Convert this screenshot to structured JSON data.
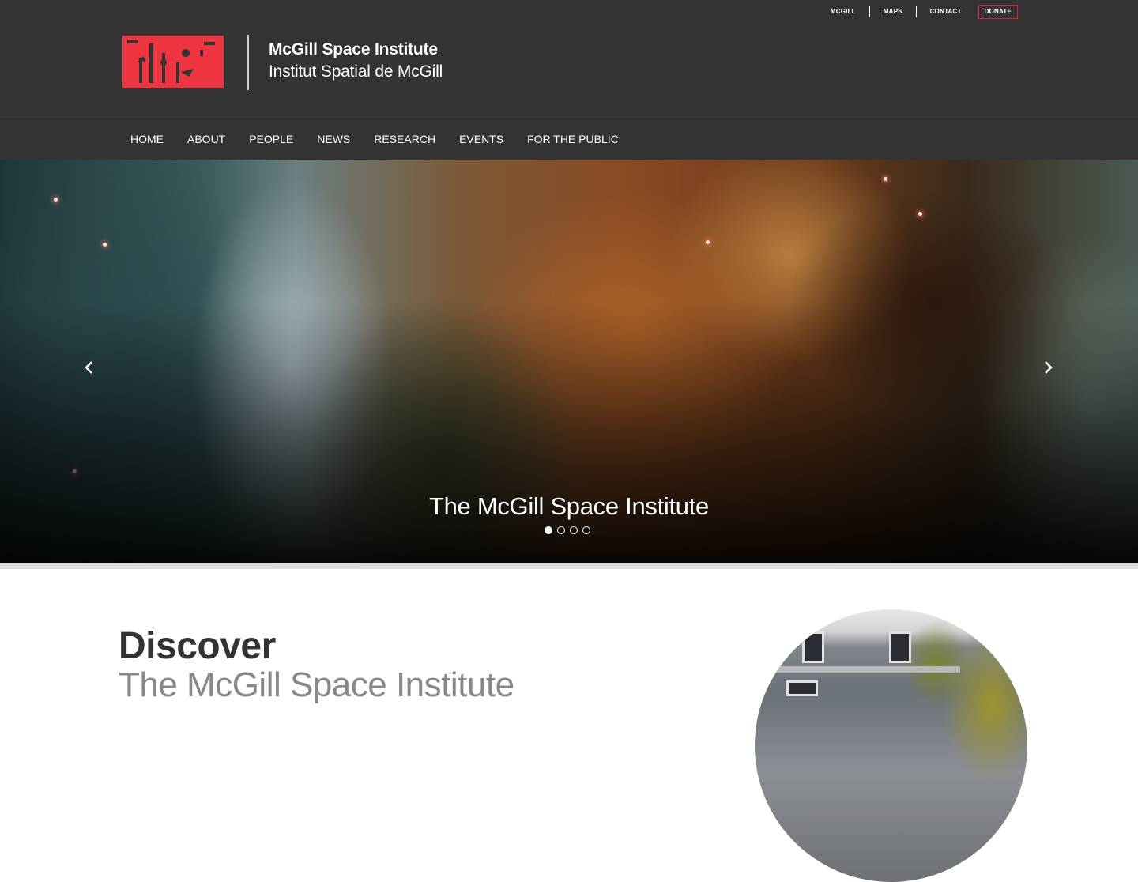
{
  "utility_nav": {
    "items": [
      "MCGILL",
      "MAPS",
      "CONTACT"
    ],
    "donate_label": "DONATE"
  },
  "brand": {
    "logo_icon": "msi-logo-icon",
    "title": "McGill Space Institute",
    "subtitle": "Institut Spatial de McGill",
    "logo_color": "#ed3440"
  },
  "main_nav": {
    "items": [
      "HOME",
      "ABOUT",
      "PEOPLE",
      "NEWS",
      "RESEARCH",
      "EVENTS",
      "FOR THE PUBLIC"
    ]
  },
  "hero": {
    "caption": "The McGill Space Institute",
    "prev_icon": "chevron-left-icon",
    "next_icon": "chevron-right-icon",
    "slide_count": 4,
    "active_slide": 1
  },
  "discover": {
    "title": "Discover",
    "subtitle": "The McGill Space Institute"
  },
  "colors": {
    "header_bg": "#333333",
    "donate_border": "#ed1b2f",
    "separator": "#dcdcdc"
  }
}
